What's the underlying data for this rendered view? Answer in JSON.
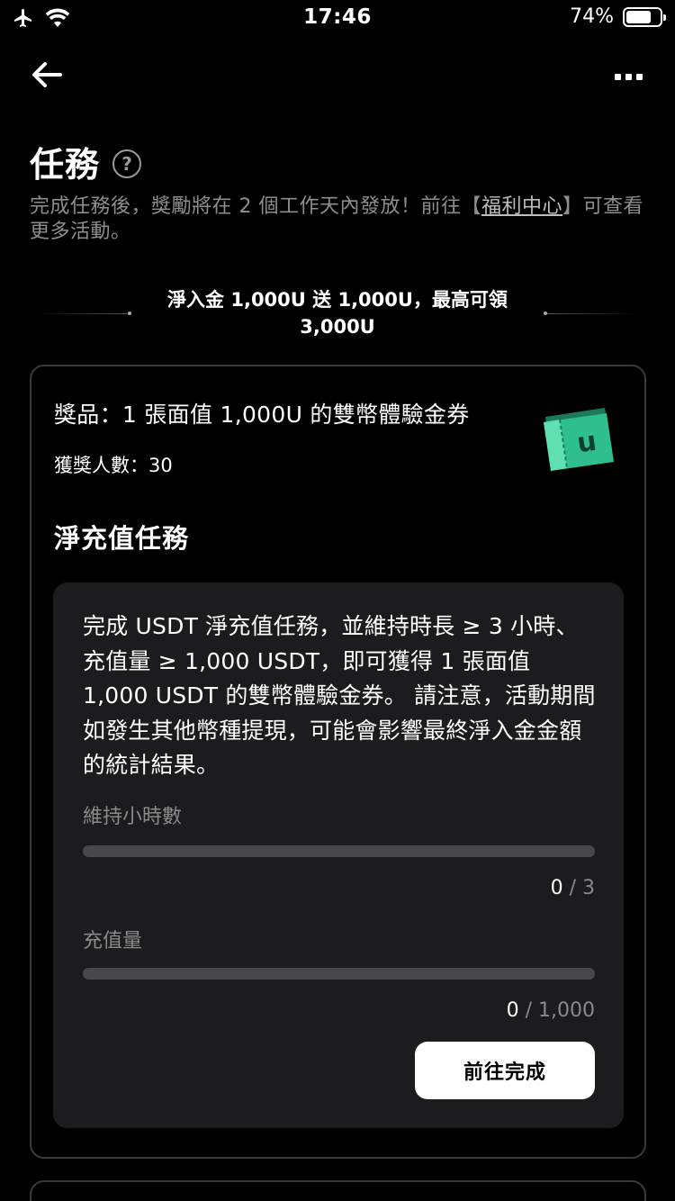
{
  "status_bar": {
    "time": "17:46",
    "battery_percent_label": "74%",
    "battery_level": 0.74,
    "icons": [
      "airplane-icon",
      "wifi-icon",
      "battery-icon"
    ]
  },
  "nav": {
    "back_icon": "arrow-left-icon",
    "more_icon": "more-dots-icon"
  },
  "page": {
    "title": "任務",
    "help_glyph": "?",
    "intro_before": "完成任務後，獎勵將在 2 個工作天內發放！前往【",
    "intro_link": "福利中心",
    "intro_after": "】可查看更多活動。"
  },
  "banner": {
    "line1": "淨入金 1,000U 送 1,000U，最高可領",
    "line2": "3,000U"
  },
  "card": {
    "prize": "獎品：1 張面值 1,000U 的雙幣體驗金券",
    "winners": "獲獎人數：30",
    "coupon_letter": "u",
    "task_title": "淨充值任務",
    "description": "完成 USDT 淨充值任務，並維持時長 ≥ 3 小時、充值量 ≥ 1,000 USDT，即可獲得 1 張面值 1,000 USDT 的雙幣體驗金券。 請注意，活動期間如發生其他幣種提現，可能會影響最終淨入金金額的統計結果。",
    "metrics": [
      {
        "label": "維持小時數",
        "current": "0",
        "separator": "/",
        "total": "3",
        "progress": 0
      },
      {
        "label": "充值量",
        "current": "0",
        "separator": "/",
        "total": "1,000",
        "progress": 0
      }
    ],
    "button_label": "前往完成"
  },
  "colors": {
    "background": "#000000",
    "card_border": "#3a3a3a",
    "inner_card": "#1c1c1e",
    "muted_text": "#8e8e8e",
    "progress_track": "#48484a",
    "coupon_green": "#2fbf8f",
    "button_bg": "#ffffff"
  }
}
